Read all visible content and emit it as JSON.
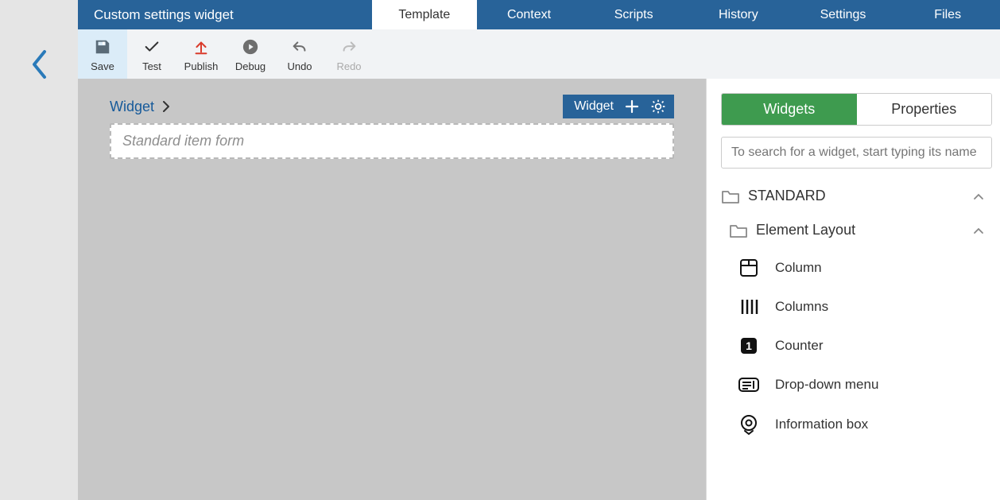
{
  "header": {
    "title": "Custom settings widget",
    "tabs": [
      "Template",
      "Context",
      "Scripts",
      "History",
      "Settings",
      "Files"
    ],
    "active_tab": "Template"
  },
  "toolbar": {
    "save": "Save",
    "test": "Test",
    "publish": "Publish",
    "debug": "Debug",
    "undo": "Undo",
    "redo": "Redo"
  },
  "canvas": {
    "breadcrumb": "Widget",
    "pill_label": "Widget",
    "form_placeholder": "Standard item form"
  },
  "sidebar": {
    "tabs": {
      "widgets": "Widgets",
      "properties": "Properties"
    },
    "search_placeholder": "To search for a widget, start typing its name",
    "group_standard": "STANDARD",
    "group_layout": "Element Layout",
    "items": {
      "column": "Column",
      "columns": "Columns",
      "counter": "Counter",
      "dropdown": "Drop-down menu",
      "infobox": "Information box"
    }
  }
}
